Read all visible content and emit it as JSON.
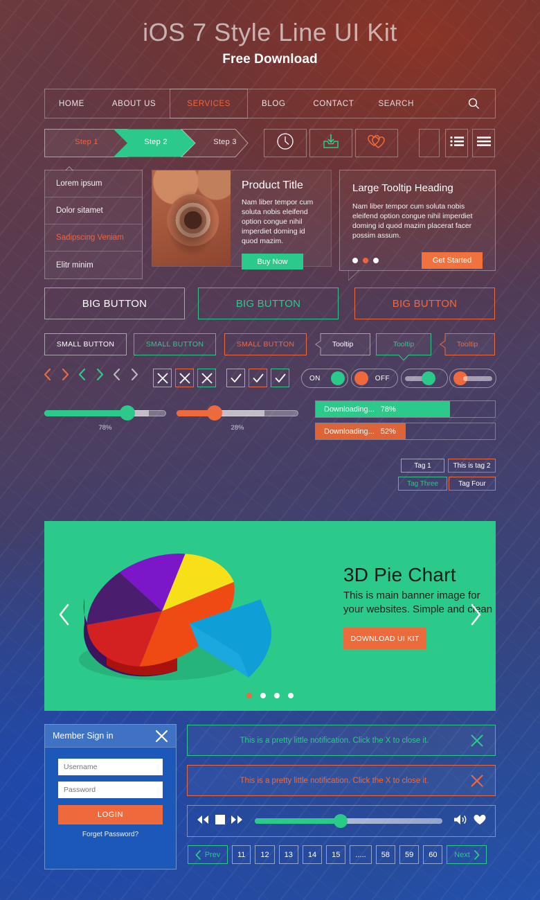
{
  "hero": {
    "title": "iOS 7 Style Line UI Kit",
    "subtitle": "Free Download"
  },
  "nav": {
    "items": [
      {
        "label": "HOME",
        "active": false
      },
      {
        "label": "ABOUT US",
        "active": false
      },
      {
        "label": "SERVICES",
        "active": true
      },
      {
        "label": "BLOG",
        "active": false
      },
      {
        "label": "CONTACT",
        "active": false
      }
    ],
    "search_label": "SEARCH",
    "search_icon": "search-icon"
  },
  "steps": {
    "items": [
      "Step 1",
      "Step 2",
      "Step 3"
    ],
    "active_index": 1
  },
  "icon_buttons": [
    {
      "name": "clock-icon"
    },
    {
      "name": "download-tray-icon"
    },
    {
      "name": "double-heart-icon"
    },
    {
      "name": "blank-icon"
    },
    {
      "name": "list-bullet-icon"
    },
    {
      "name": "list-lines-icon"
    }
  ],
  "dropdown": {
    "items": [
      {
        "label": "Lorem ipsum",
        "accent": false
      },
      {
        "label": "Dolor sitamet",
        "accent": false
      },
      {
        "label": "Sadipscing Veniam",
        "accent": true
      },
      {
        "label": "Elitr minim",
        "accent": false
      }
    ]
  },
  "product": {
    "title": "Product Title",
    "text": "Nam liber tempor cum soluta nobis eleifend option congue nihil imperdiet doming id quod mazim.",
    "button": "Buy Now"
  },
  "tooltip_card": {
    "heading": "Large Tooltip Heading",
    "text": "Nam liber tempor cum soluta nobis eleifend option congue nihil imperdiet doming id quod mazim placerat facer possim assum.",
    "button": "Get Started",
    "dots_active_index": 1,
    "dots_count": 3
  },
  "big_buttons": [
    {
      "label": "BIG BUTTON",
      "variant": "white"
    },
    {
      "label": "BIG BUTTON",
      "variant": "green"
    },
    {
      "label": "BIG BUTTON",
      "variant": "orange"
    }
  ],
  "small_buttons": [
    {
      "label": "SMALL BUTTON",
      "variant": "white"
    },
    {
      "label": "SMALL BUTTON",
      "variant": "green"
    },
    {
      "label": "SMALL BUTTON",
      "variant": "orange"
    }
  ],
  "tooltips": [
    {
      "label": "Tooltip",
      "variant": "white"
    },
    {
      "label": "Tooltip",
      "variant": "green"
    },
    {
      "label": "Tooltip",
      "variant": "orange"
    }
  ],
  "toggles": {
    "on_label": "ON",
    "off_label": "OFF"
  },
  "sliders": [
    {
      "value_label": "78%",
      "value": 78,
      "color": "#2bc98a"
    },
    {
      "value_label": "28%",
      "value": 28,
      "color": "#ee6a3c"
    }
  ],
  "progress": [
    {
      "label": "Downloading...",
      "value_label": "78%",
      "value": 78,
      "color": "#2bc98a"
    },
    {
      "label": "Downloading...",
      "value_label": "52%",
      "value": 52,
      "color": "#dd6436"
    }
  ],
  "tags": [
    {
      "label": "Tag 1",
      "variant": "w"
    },
    {
      "label": "This is tag 2",
      "variant": "o"
    },
    {
      "label": "Tag Three",
      "variant": "g"
    },
    {
      "label": "Tag Four",
      "variant": "o2"
    }
  ],
  "banner": {
    "title": "3D Pie Chart",
    "text": "This is main banner image for your websites. Simple and clean",
    "button": "DOWNLOAD UI KIT",
    "prev_icon": "chevron-left-icon",
    "next_icon": "chevron-right-icon",
    "dots_count": 4,
    "dots_active_index": 0
  },
  "login": {
    "title": "Member Sign in",
    "close_icon": "close-icon",
    "username_placeholder": "Username",
    "password_placeholder": "Password",
    "button": "LOGIN",
    "forget": "Forget Password?"
  },
  "notifications": [
    {
      "message": "This is a pretty little notification. Click the X to close it.",
      "variant": "green"
    },
    {
      "message": "This is a pretty little notification. Click the X to close it.",
      "variant": "orange"
    }
  ],
  "player": {
    "rewind_icon": "rewind-icon",
    "stop_icon": "stop-icon",
    "forward_icon": "fast-forward-icon",
    "volume_icon": "volume-icon",
    "like_icon": "heart-icon",
    "progress": 45
  },
  "pagination": {
    "prev": "Prev",
    "next": "Next",
    "pages": [
      "11",
      "12",
      "13",
      "14",
      "15",
      ".....",
      "58",
      "59",
      "60"
    ]
  },
  "colors": {
    "green": "#2bc98a",
    "orange": "#ee6a3c",
    "blue": "#1c58b8",
    "white": "#ffffff"
  },
  "chart_data": {
    "type": "pie",
    "title": "3D Pie Chart",
    "labels": [
      "Yellow",
      "Cyan",
      "Red",
      "Purple",
      "Violet",
      "Orange"
    ],
    "values": [
      18,
      25,
      17,
      15,
      13,
      12
    ],
    "colors": [
      "#f7e017",
      "#29b6e8",
      "#d32020",
      "#4a1d6e",
      "#7c17c9",
      "#f04a14"
    ],
    "legend": "none",
    "grid": false
  }
}
